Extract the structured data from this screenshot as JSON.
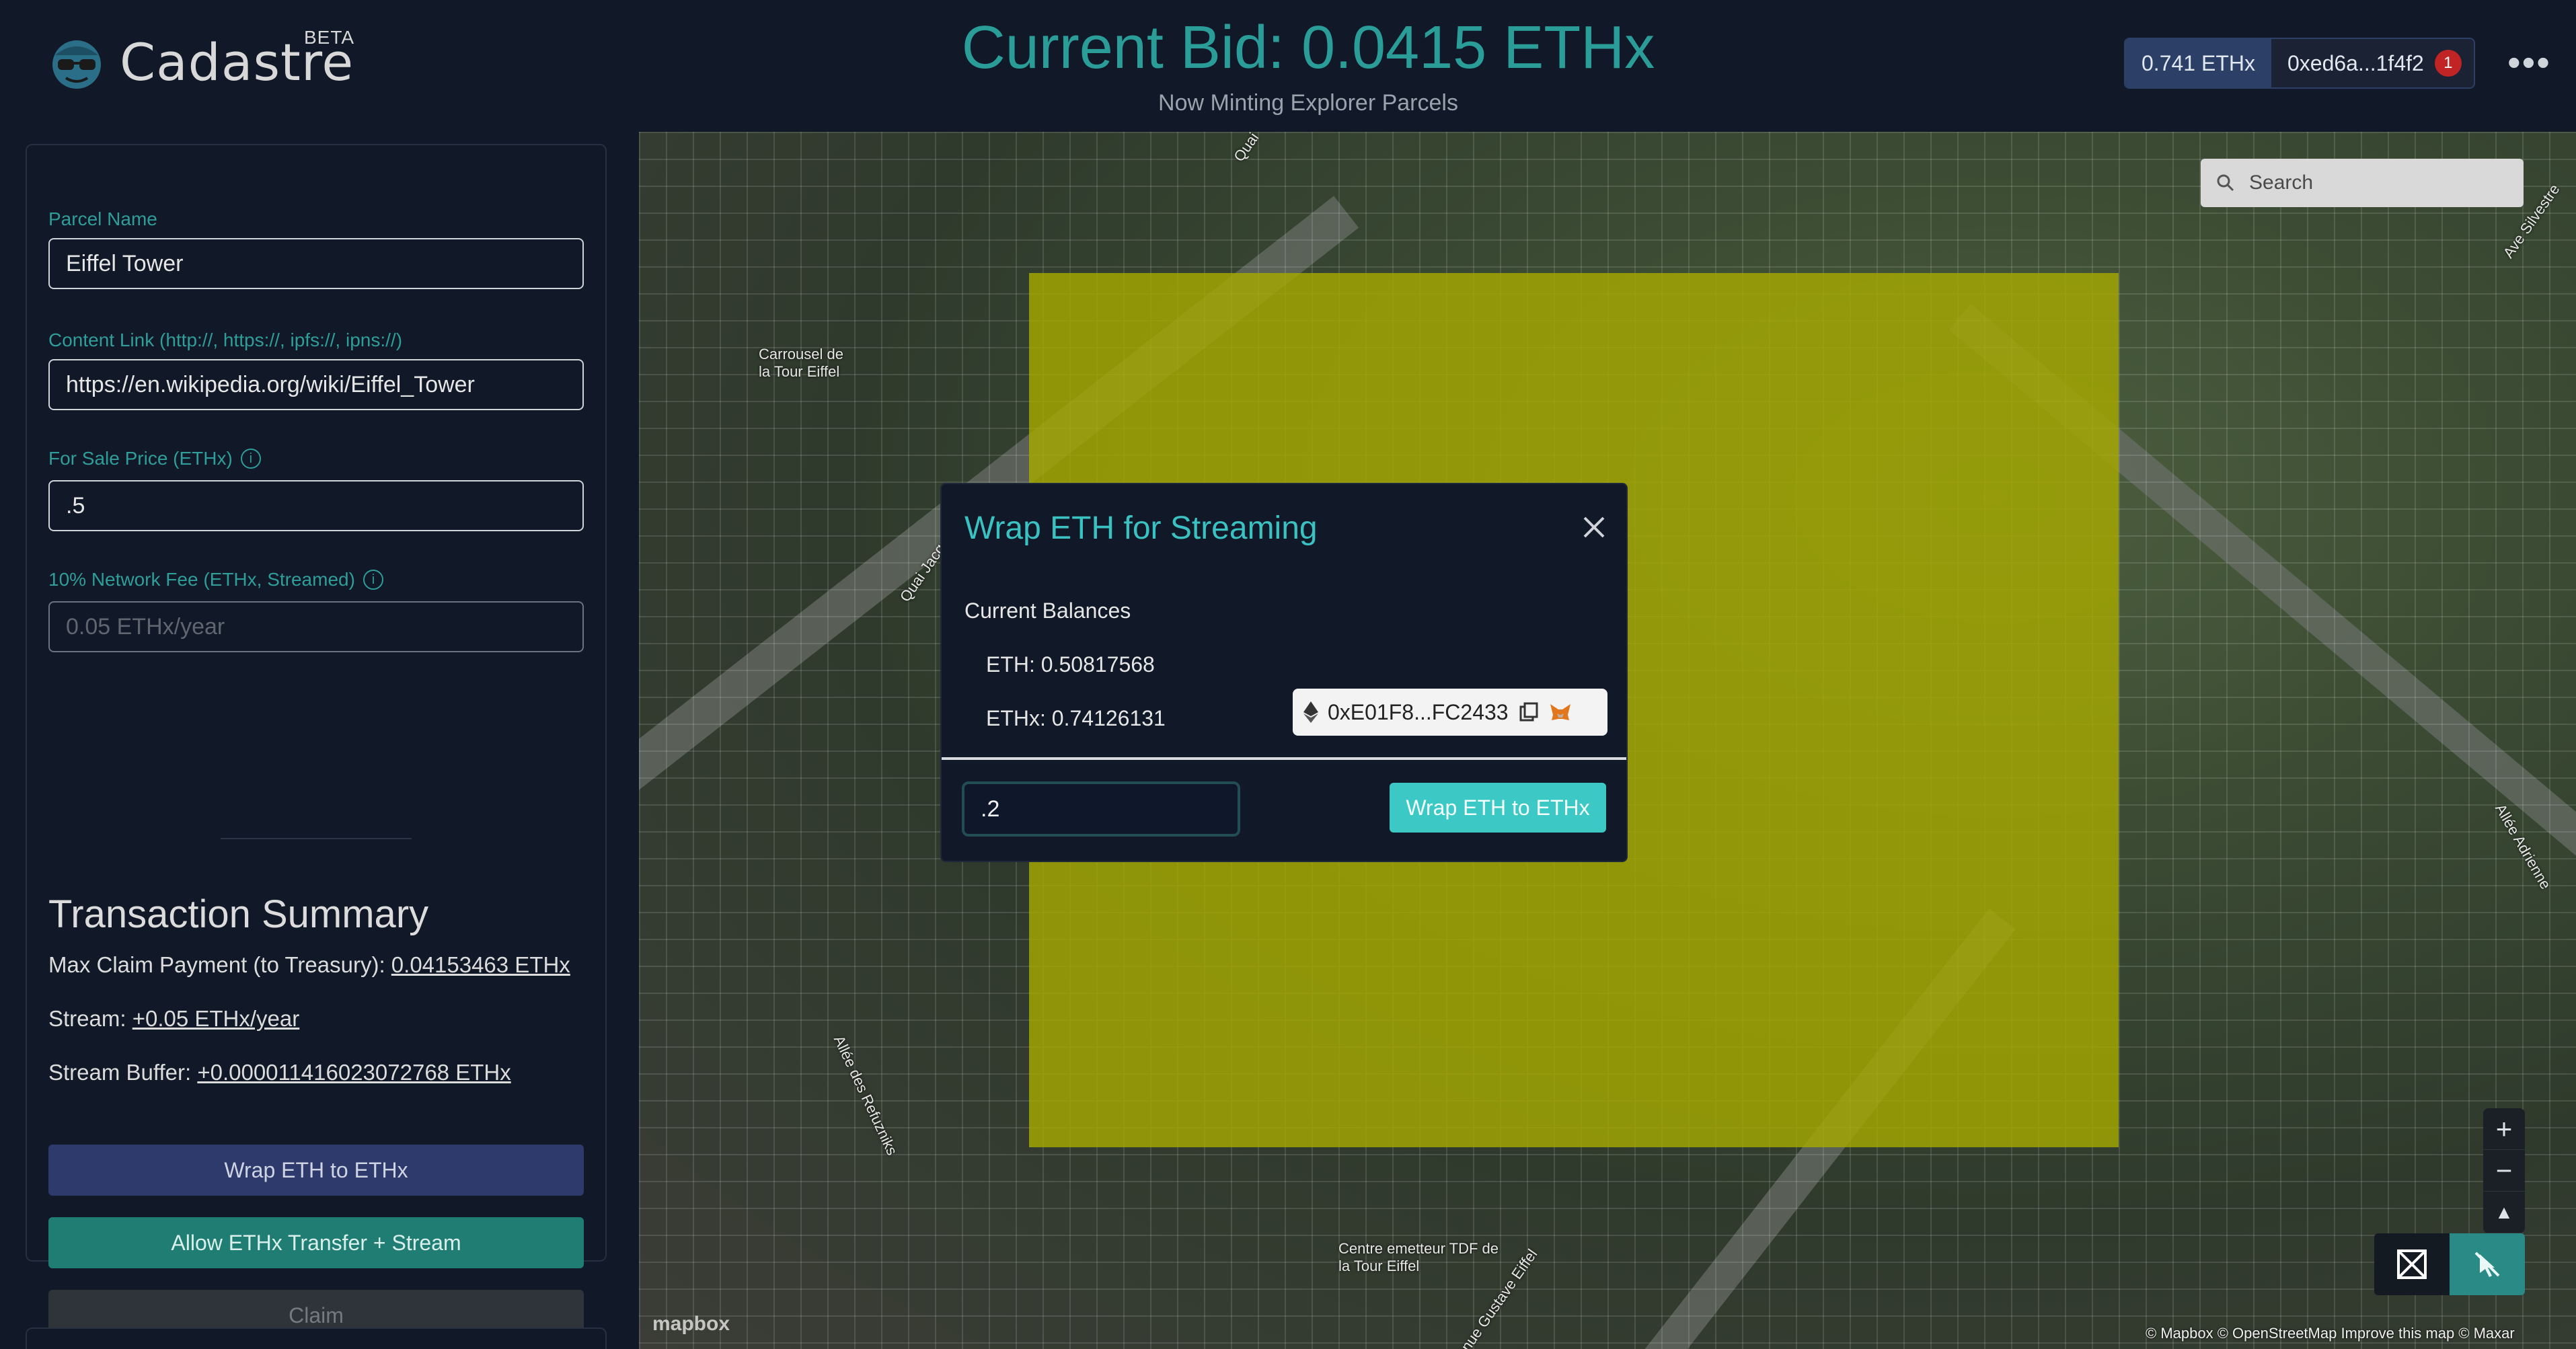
{
  "header": {
    "brand": "Cadastre",
    "beta": "BETA",
    "bid_title": "Current Bid: 0.0415 ETHx",
    "bid_subtitle": "Now Minting Explorer Parcels",
    "wallet_balance": "0.741 ETHx",
    "wallet_address": "0xed6a...1f4f2",
    "notification_count": "1",
    "more_label": "•••"
  },
  "form": {
    "parcel_name_label": "Parcel Name",
    "parcel_name_value": "Eiffel Tower",
    "content_link_label": "Content Link (http://, https://, ipfs://, ipns://)",
    "content_link_value": "https://en.wikipedia.org/wiki/Eiffel_Tower",
    "sale_price_label": "For Sale Price (ETHx)",
    "sale_price_value": ".5",
    "network_fee_label": "10% Network Fee (ETHx, Streamed)",
    "network_fee_value": "0.05 ETHx/year"
  },
  "summary": {
    "title": "Transaction Summary",
    "max_claim_label": "Max Claim Payment (to Treasury):",
    "max_claim_value": "0.04153463 ETHx",
    "stream_label": "Stream:",
    "stream_value": "+0.05 ETHx/year",
    "buffer_label": "Stream Buffer:",
    "buffer_value": "+0.000011416023072768 ETHx"
  },
  "buttons": {
    "wrap": "Wrap ETH to ETHx",
    "allow": "Allow ETHx Transfer + Stream",
    "claim": "Claim"
  },
  "map": {
    "search_placeholder": "Search",
    "labels": [
      "Carrousel de la Tour Eiffel",
      "Quai Jacques Chirac",
      "Allée des Refuzniks",
      "Centre emetteur TDF de la Tour Eiffel",
      "Avenue Gustave Eiffel",
      "Allée Adrienne",
      "Ave Silvestre",
      "Quai"
    ],
    "attribution": "© Mapbox © OpenStreetMap  Improve this map © Maxar",
    "logo": "mapbox",
    "zoom_in": "+",
    "zoom_out": "−",
    "compass": "▲"
  },
  "modal": {
    "title": "Wrap ETH for Streaming",
    "current_balances_label": "Current Balances",
    "eth_balance": "ETH: 0.50817568",
    "ethx_balance": "ETHx: 0.74126131",
    "account": "0xE01F8...FC2433",
    "amount_value": ".2",
    "submit": "Wrap ETH to ETHx"
  },
  "colors": {
    "accent_teal": "#3ac1c1",
    "parcel": "#a5a800",
    "background": "#111827"
  }
}
